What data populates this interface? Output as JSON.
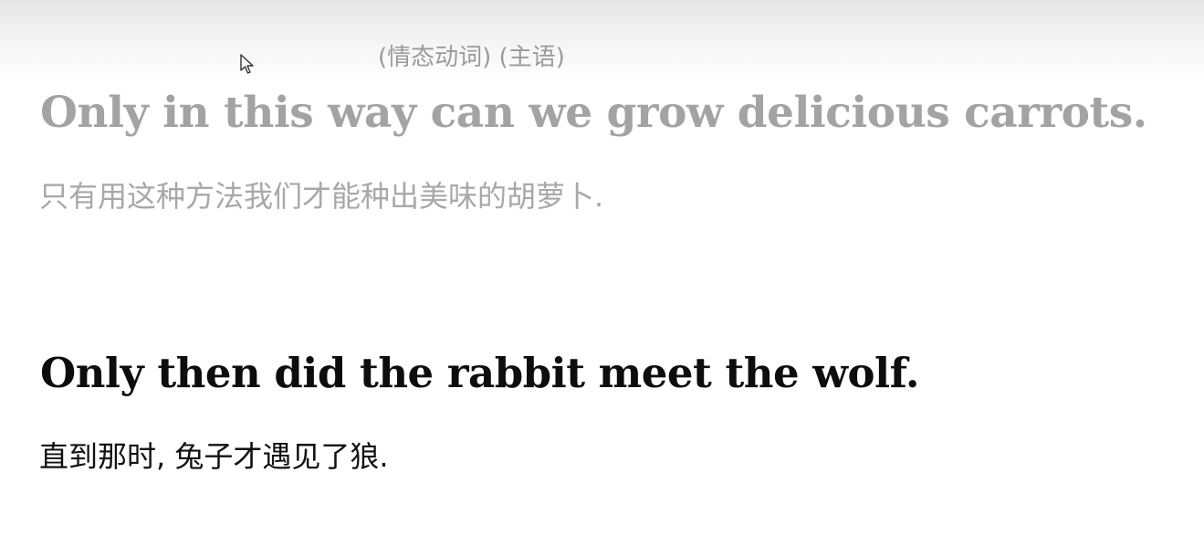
{
  "annotation": {
    "text": "(情态动词) (主语)"
  },
  "sentences": [
    {
      "english": "Only in this way can we grow delicious carrots.",
      "chinese": "只有用这种方法我们才能种出美味的胡萝卜.",
      "state": "faded"
    },
    {
      "english": "Only then did the rabbit meet the wolf.",
      "chinese": "直到那时, 兔子才遇见了狼.",
      "state": "active"
    }
  ],
  "colors": {
    "faded_text": "#a3a3a3",
    "active_text": "#0d0d0d",
    "annotation_text": "#9a9a9a",
    "background": "#ffffff"
  },
  "icons": {
    "cursor": "mouse-pointer-icon"
  }
}
